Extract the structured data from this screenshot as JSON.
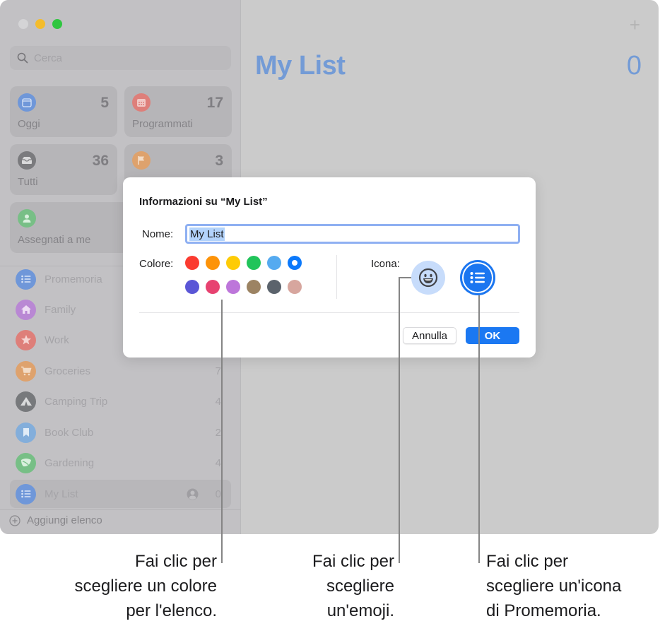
{
  "window": {
    "traffic_lights": [
      "close",
      "minimize",
      "maximize"
    ]
  },
  "sidebar": {
    "search": {
      "placeholder": "Cerca",
      "icon": "search-icon"
    },
    "smart_lists": [
      {
        "label": "Oggi",
        "count": "5",
        "icon": "calendar-today-icon",
        "color": "#6f97d9"
      },
      {
        "label": "Programmati",
        "count": "17",
        "icon": "calendar-scheduled-icon",
        "color": "#de7f7a"
      },
      {
        "label": "Tutti",
        "count": "36",
        "icon": "tray-icon",
        "color": "#7b7b7e"
      },
      {
        "label": "",
        "count": "3",
        "icon": "flag-icon",
        "color": "#dea26d"
      },
      {
        "label": "Assegnati a me",
        "count": "",
        "icon": "person-icon",
        "color": "#78bf86"
      }
    ],
    "lists": [
      {
        "label": "Promemoria",
        "count": "",
        "icon": "list-bullet-icon",
        "color": "#6f97d9"
      },
      {
        "label": "Family",
        "count": "",
        "icon": "house-icon",
        "color": "#b988d4"
      },
      {
        "label": "Work",
        "count": "",
        "icon": "star-icon",
        "color": "#de7f7a"
      },
      {
        "label": "Groceries",
        "count": "7",
        "icon": "cart-icon",
        "color": "#dea26d"
      },
      {
        "label": "Camping Trip",
        "count": "4",
        "icon": "tent-icon",
        "color": "#77797c"
      },
      {
        "label": "Book Club",
        "count": "2",
        "icon": "bookmark-icon",
        "color": "#83aedb"
      },
      {
        "label": "Gardening",
        "count": "4",
        "icon": "leaf-icon",
        "color": "#77bf86"
      },
      {
        "label": "My List",
        "count": "0",
        "icon": "list-bullet-icon",
        "color": "#6f97d9",
        "selected": true,
        "shared": true
      }
    ],
    "add_list_label": "Aggiungi elenco"
  },
  "main": {
    "title": "My List",
    "count": "0",
    "add_button": "+"
  },
  "dialog": {
    "title": "Informazioni su “My List”",
    "name_label": "Nome:",
    "name_value": "My List",
    "color_label": "Colore:",
    "colors": [
      {
        "name": "red",
        "hex": "#fb3b30"
      },
      {
        "name": "orange",
        "hex": "#fd9308"
      },
      {
        "name": "yellow",
        "hex": "#fecb06"
      },
      {
        "name": "green",
        "hex": "#21c45a"
      },
      {
        "name": "light-blue",
        "hex": "#55aaf0"
      },
      {
        "name": "blue",
        "hex": "#0b79fb",
        "selected": true
      },
      {
        "name": "indigo",
        "hex": "#5a56d6"
      },
      {
        "name": "pink",
        "hex": "#e74270"
      },
      {
        "name": "purple",
        "hex": "#bd76da"
      },
      {
        "name": "brown",
        "hex": "#9c8363"
      },
      {
        "name": "gray",
        "hex": "#5b636c"
      },
      {
        "name": "rose",
        "hex": "#d7a69e"
      }
    ],
    "icon_label": "Icona:",
    "icon_options": [
      "emoji-icon",
      "list-bullet-icon"
    ],
    "cancel_label": "Annulla",
    "ok_label": "OK"
  },
  "callouts": [
    {
      "lines": [
        "Fai clic per",
        "scegliere un colore",
        "per l'elenco."
      ]
    },
    {
      "lines": [
        "Fai clic per",
        "scegliere",
        "un'emoji."
      ]
    },
    {
      "lines": [
        "Fai clic per",
        "scegliere un'icona",
        "di Promemoria."
      ]
    }
  ]
}
